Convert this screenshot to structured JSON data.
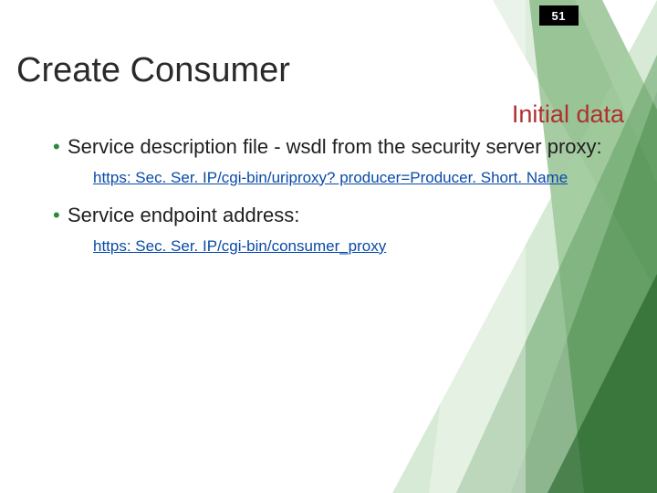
{
  "page_number": "51",
  "title": "Create Consumer",
  "subtitle": "Initial data",
  "bullets": [
    {
      "text": "Service description file - wsdl from the security server proxy:",
      "link": "https: Sec. Ser. IP/cgi-bin/uriproxy? producer=Producer. Short. Name"
    },
    {
      "text": "Service endpoint address:",
      "link": "https: Sec. Ser. IP/cgi-bin/consumer_proxy"
    }
  ]
}
